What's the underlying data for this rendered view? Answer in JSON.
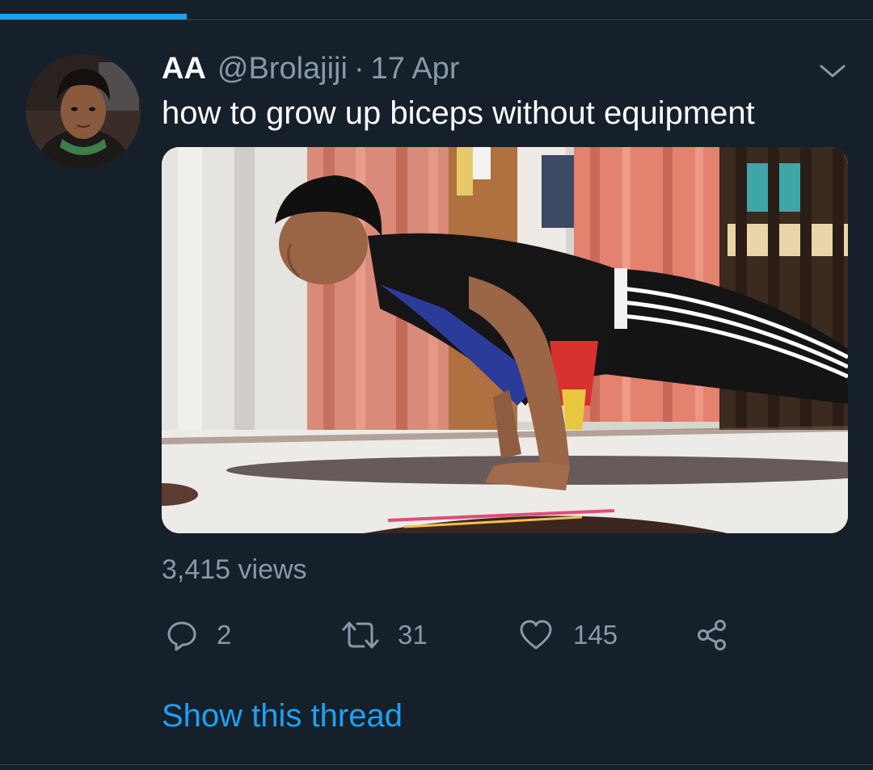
{
  "progress": {
    "fraction": 0.214
  },
  "tweet": {
    "display_name": "AA",
    "handle": "@Brolajiji",
    "separator": "·",
    "date": "17 Apr",
    "text": "how to grow up biceps without equipment",
    "views": "3,415 views",
    "actions": {
      "reply": {
        "icon": "reply-icon",
        "count": "2"
      },
      "retweet": {
        "icon": "retweet-icon",
        "count": "31"
      },
      "like": {
        "icon": "heart-icon",
        "count": "145"
      },
      "share": {
        "icon": "share-icon"
      }
    },
    "show_thread": "Show this thread",
    "menu_icon": "chevron-down-icon"
  },
  "colors": {
    "background": "#15202b",
    "accent": "#1da1f2",
    "secondary_text": "#8899a6",
    "divider": "#38444d"
  }
}
